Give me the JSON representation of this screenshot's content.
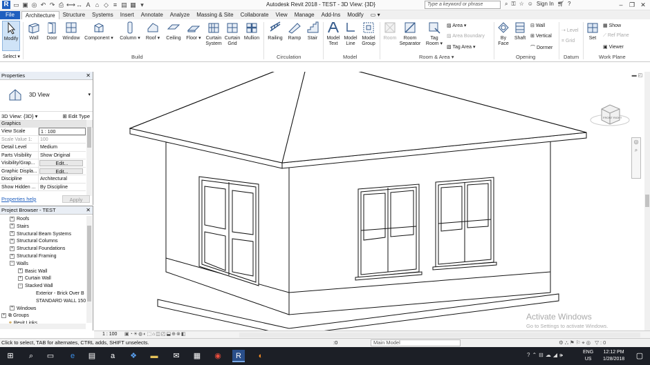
{
  "titlebar": {
    "title": "Autodesk Revit 2018 -    TEST - 3D View: {3D}",
    "search_placeholder": "Type a keyword or phrase",
    "sign_in": "Sign In"
  },
  "tabs": [
    "File",
    "Architecture",
    "Structure",
    "Systems",
    "Insert",
    "Annotate",
    "Analyze",
    "Massing & Site",
    "Collaborate",
    "View",
    "Manage",
    "Add-Ins",
    "Modify"
  ],
  "active_tab": "Architecture",
  "ribbon": {
    "modify": "Modify",
    "select": "Select",
    "build": [
      "Wall",
      "Door",
      "Window",
      "Component",
      "Column",
      "Roof",
      "Ceiling",
      "Floor",
      "Curtain System",
      "Curtain Grid",
      "Mullion"
    ],
    "build_label": "Build",
    "circulation": [
      "Railing",
      "Ramp",
      "Stair"
    ],
    "circulation_label": "Circulation",
    "model": [
      "Model Text",
      "Model Line",
      "Model Group"
    ],
    "model_label": "Model",
    "room": [
      "Room",
      "Room Separator",
      "Tag Room"
    ],
    "area": "Area",
    "area_boundary": "Area Boundary",
    "tag_area": "Tag Area",
    "room_label": "Room & Area",
    "opening": [
      "By Face",
      "Shaft"
    ],
    "opening_wall": "Wall",
    "opening_vertical": "Vertical",
    "opening_dormer": "Dormer",
    "opening_label": "Opening",
    "datum_level": "Level",
    "datum_grid": "Grid",
    "datum_label": "Datum",
    "set": "Set",
    "show": "Show",
    "ref_plane": "Ref Plane",
    "viewer": "Viewer",
    "workplane_label": "Work Plane"
  },
  "properties": {
    "title": "Properties",
    "type_name": "3D View",
    "selector": "3D View: {3D}",
    "edit_type": "Edit Type",
    "group": "Graphics",
    "rows": [
      {
        "k": "View Scale",
        "v": "1 : 100"
      },
      {
        "k": "Scale Value    1:",
        "v": "100"
      },
      {
        "k": "Detail Level",
        "v": "Medium"
      },
      {
        "k": "Parts Visibility",
        "v": "Show Original"
      },
      {
        "k": "Visibility/Grap...",
        "v": "Edit..."
      },
      {
        "k": "Graphic Displa...",
        "v": "Edit..."
      },
      {
        "k": "Discipline",
        "v": "Architectural"
      },
      {
        "k": "Show Hidden ...",
        "v": "By Discipline"
      }
    ],
    "help": "Properties help",
    "apply": "Apply"
  },
  "browser": {
    "title": "Project Browser - TEST",
    "items": [
      {
        "label": "Roofs",
        "level": 1,
        "pm": "+"
      },
      {
        "label": "Stairs",
        "level": 1,
        "pm": "+"
      },
      {
        "label": "Structural Beam Systems",
        "level": 1,
        "pm": "+"
      },
      {
        "label": "Structural Columns",
        "level": 1,
        "pm": "+"
      },
      {
        "label": "Structural Foundations",
        "level": 1,
        "pm": "+"
      },
      {
        "label": "Structural Framing",
        "level": 1,
        "pm": "+"
      },
      {
        "label": "Walls",
        "level": 1,
        "pm": "-"
      },
      {
        "label": "Basic Wall",
        "level": 2,
        "pm": "+"
      },
      {
        "label": "Curtain Wall",
        "level": 2,
        "pm": "+"
      },
      {
        "label": "Stacked Wall",
        "level": 2,
        "pm": "-"
      },
      {
        "label": "Exterior - Brick Over B",
        "level": 3,
        "pm": ""
      },
      {
        "label": "STANDARD WALL 150",
        "level": 3,
        "pm": ""
      },
      {
        "label": "Windows",
        "level": 1,
        "pm": "+"
      },
      {
        "label": "Groups",
        "level": 0,
        "pm": "+"
      },
      {
        "label": "Revit Links",
        "level": 0,
        "pm": ""
      }
    ]
  },
  "viewport": {
    "cube_label": "FRONT  RIGHT",
    "activate_title": "Activate Windows",
    "activate_sub": "Go to Settings to activate Windows."
  },
  "view_control": {
    "scale": "1 : 100"
  },
  "status": {
    "message": "Click to select, TAB for alternates, CTRL adds, SHIFT unselects.",
    "count": ":0",
    "workset": "Main Model",
    "filter": ":0"
  },
  "taskbar": {
    "lang": "ENG",
    "region": "US",
    "time": "12:12 PM",
    "date": "1/28/2018"
  },
  "colors": {
    "accent": "#1f5fbf",
    "taskbar": "#1c1f26"
  }
}
